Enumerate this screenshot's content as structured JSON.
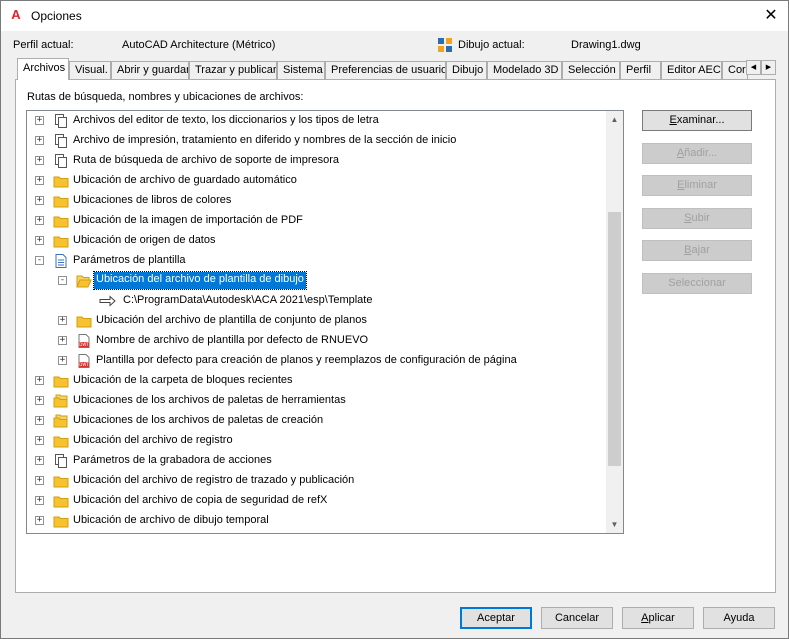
{
  "window": {
    "title": "Opciones",
    "close": "✕"
  },
  "header": {
    "profile_label": "Perfil actual:",
    "profile_value": "AutoCAD Architecture (Métrico)",
    "drawing_label": "Dibujo actual:",
    "drawing_value": "Drawing1.dwg"
  },
  "tabs": [
    {
      "label": "Archivos",
      "active": true
    },
    {
      "label": "Visual."
    },
    {
      "label": "Abrir y guardar"
    },
    {
      "label": "Trazar y publicar"
    },
    {
      "label": "Sistema"
    },
    {
      "label": "Preferencias de usuario"
    },
    {
      "label": "Dibujo"
    },
    {
      "label": "Modelado 3D"
    },
    {
      "label": "Selección"
    },
    {
      "label": "Perfil"
    },
    {
      "label": "Editor AEC"
    },
    {
      "label": "Cor"
    }
  ],
  "panel": {
    "label": "Rutas de búsqueda, nombres y ubicaciones de archivos:"
  },
  "tree": [
    {
      "label": "Archivos del editor de texto, los diccionarios y los tipos de letra",
      "icon": "copy-icon",
      "level": 0,
      "expander": "+"
    },
    {
      "label": "Archivo de impresión, tratamiento en diferido y nombres de la sección de inicio",
      "icon": "copy-icon",
      "level": 0,
      "expander": "+"
    },
    {
      "label": "Ruta de búsqueda de archivo de soporte de impresora",
      "icon": "copy-icon",
      "level": 0,
      "expander": "+"
    },
    {
      "label": "Ubicación de archivo de guardado automático",
      "icon": "folder-icon",
      "level": 0,
      "expander": "+"
    },
    {
      "label": "Ubicaciones de libros de colores",
      "icon": "folder-icon",
      "level": 0,
      "expander": "+"
    },
    {
      "label": "Ubicación de la imagen de importación de PDF",
      "icon": "folder-icon",
      "level": 0,
      "expander": "+"
    },
    {
      "label": "Ubicación de origen de datos",
      "icon": "folder-icon",
      "level": 0,
      "expander": "+"
    },
    {
      "label": "Parámetros de plantilla",
      "icon": "document-icon",
      "level": 0,
      "expander": "−"
    },
    {
      "label": "Ubicación del archivo de plantilla de dibujo",
      "icon": "open-folder-icon",
      "level": 1,
      "expander": "−",
      "selected": true
    },
    {
      "label": "C:\\ProgramData\\Autodesk\\ACA 2021\\esp\\Template",
      "icon": "arrow-icon",
      "level": 2,
      "expander": ""
    },
    {
      "label": "Ubicación del archivo de plantilla de conjunto de planos",
      "icon": "folder-icon",
      "level": 1,
      "expander": "+"
    },
    {
      "label": "Nombre de archivo de plantilla por defecto de RNUEVO",
      "icon": "dwt-file-icon",
      "level": 1,
      "expander": "+"
    },
    {
      "label": "Plantilla por defecto para creación de planos y reemplazos de configuración de página",
      "icon": "dwt-file-icon",
      "level": 1,
      "expander": "+"
    },
    {
      "label": "Ubicación de la carpeta de bloques recientes",
      "icon": "folder-icon",
      "level": 0,
      "expander": "+"
    },
    {
      "label": "Ubicaciones de los archivos de paletas de herramientas",
      "icon": "folder-stack-icon",
      "level": 0,
      "expander": "+"
    },
    {
      "label": "Ubicaciones de los archivos de paletas de creación",
      "icon": "folder-stack-icon",
      "level": 0,
      "expander": "+"
    },
    {
      "label": "Ubicación del archivo de registro",
      "icon": "folder-icon",
      "level": 0,
      "expander": "+"
    },
    {
      "label": "Parámetros de la grabadora de acciones",
      "icon": "copy-icon",
      "level": 0,
      "expander": "+"
    },
    {
      "label": "Ubicación del archivo de registro de trazado y publicación",
      "icon": "folder-icon",
      "level": 0,
      "expander": "+"
    },
    {
      "label": "Ubicación del archivo de copia de seguridad de refX",
      "icon": "folder-icon",
      "level": 0,
      "expander": "+"
    },
    {
      "label": "Ubicación de archivo de dibujo temporal",
      "icon": "folder-icon",
      "level": 0,
      "expander": "+"
    }
  ],
  "side_buttons": [
    {
      "pre": "",
      "u": "E",
      "post": "xaminar...",
      "enabled": true
    },
    {
      "pre": "",
      "u": "A",
      "post": "ñadir...",
      "enabled": false
    },
    {
      "pre": "",
      "u": "E",
      "post": "liminar",
      "enabled": false
    },
    {
      "pre": "",
      "u": "S",
      "post": "ubir",
      "enabled": false
    },
    {
      "pre": "",
      "u": "B",
      "post": "ajar",
      "enabled": false
    },
    {
      "pre": "",
      "u": "",
      "post": "Seleccionar",
      "enabled": false
    }
  ],
  "footer": {
    "ok": "Aceptar",
    "cancel": "Cancelar",
    "apply_u": "A",
    "apply_rest": "plicar",
    "help": "Ayuda"
  },
  "colors": {
    "selection": "#0078d7",
    "folder": "#f7c22f",
    "dwt_red": "#d8342d"
  }
}
